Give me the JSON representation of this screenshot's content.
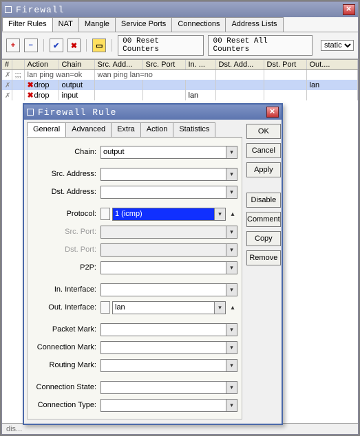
{
  "main_window": {
    "title": "Firewall",
    "tabs": [
      "Filter Rules",
      "NAT",
      "Mangle",
      "Service Ports",
      "Connections",
      "Address Lists"
    ],
    "active_tab": 0,
    "toolbar": {
      "reset_counters": "00 Reset Counters",
      "reset_all_counters": "00 Reset All Counters",
      "filter_select": "static",
      "filter_options": [
        "static"
      ]
    },
    "columns": [
      "#",
      "",
      "Action",
      "Chain",
      "Src. Add...",
      "Src. Port",
      "In. ...",
      "Dst. Add...",
      "Dst. Port",
      "Out...."
    ],
    "rows": [
      {
        "kind": "comment",
        "hash": "",
        "flag": ";;;",
        "action": "lan ping wan=ok",
        "chain": "",
        "src_addr": "wan ping lan=no",
        "src_port": "",
        "in": "",
        "dst_addr": "",
        "dst_port": "",
        "out": ""
      },
      {
        "kind": "selected",
        "hash": "",
        "flag": "",
        "action": "drop",
        "chain": "output",
        "src_addr": "",
        "src_port": "",
        "in": "",
        "dst_addr": "",
        "dst_port": "",
        "out": "lan"
      },
      {
        "kind": "normal",
        "hash": "",
        "flag": "",
        "action": "drop",
        "chain": "input",
        "src_addr": "",
        "src_port": "",
        "in": "lan",
        "dst_addr": "",
        "dst_port": "",
        "out": ""
      }
    ],
    "status_placeholder": "dis..."
  },
  "dialog": {
    "title": "Firewall Rule",
    "tabs": [
      "General",
      "Advanced",
      "Extra",
      "Action",
      "Statistics"
    ],
    "active_tab": 0,
    "buttons": {
      "ok": "OK",
      "cancel": "Cancel",
      "apply": "Apply",
      "disable": "Disable",
      "comment": "Comment",
      "copy": "Copy",
      "remove": "Remove"
    },
    "form": {
      "labels": {
        "chain": "Chain:",
        "src_addr": "Src. Address:",
        "dst_addr": "Dst. Address:",
        "protocol": "Protocol:",
        "src_port": "Src. Port:",
        "dst_port": "Dst. Port:",
        "p2p": "P2P:",
        "in_if": "In. Interface:",
        "out_if": "Out. Interface:",
        "packet_mark": "Packet Mark:",
        "conn_mark": "Connection Mark:",
        "routing_mark": "Routing Mark:",
        "conn_state": "Connection State:",
        "conn_type": "Connection Type:"
      },
      "values": {
        "chain": "output",
        "src_addr": "",
        "dst_addr": "",
        "protocol": "1 (icmp)",
        "src_port": "",
        "dst_port": "",
        "p2p": "",
        "in_if": "",
        "out_if": "lan",
        "packet_mark": "",
        "conn_mark": "",
        "routing_mark": "",
        "conn_state": "",
        "conn_type": ""
      }
    }
  }
}
